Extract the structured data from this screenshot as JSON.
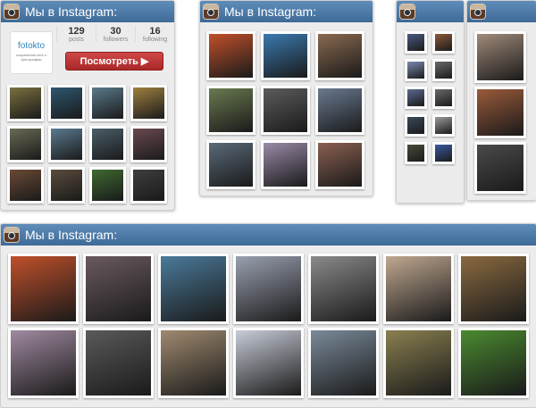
{
  "widget_title": "Мы в Instagram:",
  "profile": {
    "logo_text": "fotokto",
    "logo_subtitle": "социальная сеть о фотографии",
    "stats": [
      {
        "value": "129",
        "label": "posts"
      },
      {
        "value": "30",
        "label": "followers"
      },
      {
        "value": "16",
        "label": "following"
      }
    ],
    "view_button": "Посмотреть ▶"
  },
  "photo_colors": {
    "w1": [
      "#7a7040",
      "#2e5670",
      "#5a7a8a",
      "#a08040",
      "#6a6a55",
      "#5a7a90",
      "#4a5e6a",
      "#6a4a50",
      "#6a4a35",
      "#5a4c3c",
      "#3e6a30",
      "#3e3e3e"
    ],
    "w2": [
      "#c0502a",
      "#3a7ab0",
      "#8a6a50",
      "#6a7a50",
      "#5c5c5c",
      "#6a7a90",
      "#5a6a78",
      "#9a8aa8",
      "#8a6050"
    ],
    "w3": [
      "#4a5a80",
      "#8a5a3a",
      "#7a8ab0",
      "#6a6a6a",
      "#5a6a90",
      "#6a6a6a",
      "#3a4a5a",
      "#9a9a9a",
      "#4a4a3a",
      "#3a5aa0"
    ],
    "w4": [
      "#a08a7a",
      "#9a5a3a",
      "#4a4a4a"
    ],
    "w5": [
      "#c0502a",
      "#6a5a60",
      "#4a7a9a",
      "#9aa0b0",
      "#8a8a8a",
      "#c0a890",
      "#8a6a40",
      "#a08aa0",
      "#5a5a5a",
      "#a08a70",
      "#c8ccd8",
      "#7a8a9a",
      "#8a8050",
      "#4a8a30"
    ]
  }
}
